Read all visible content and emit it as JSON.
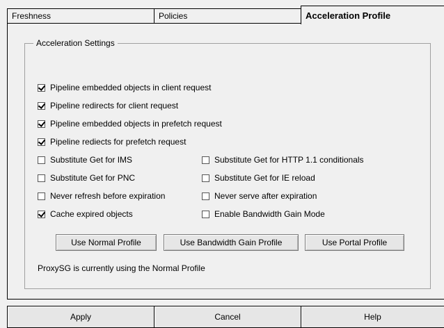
{
  "tabs": [
    {
      "label": "Freshness",
      "active": false
    },
    {
      "label": "Policies",
      "active": false
    },
    {
      "label": "Acceleration Profile",
      "active": true
    }
  ],
  "group": {
    "title": "Acceleration Settings",
    "checkboxes": [
      {
        "label": "Pipeline embedded objects in client request",
        "checked": true
      },
      {
        "label": "Pipeline redirects for client request",
        "checked": true
      },
      {
        "label": "Pipeline embedded objects in prefetch request",
        "checked": true
      },
      {
        "label": "Pipeline rediects for prefetch request",
        "checked": true
      },
      {
        "label": "Substitute Get for IMS",
        "checked": false
      },
      {
        "label": "Substitute Get for HTTP 1.1 conditionals",
        "checked": false
      },
      {
        "label": "Substitute Get for PNC",
        "checked": false
      },
      {
        "label": "Substitute Get for IE reload",
        "checked": false
      },
      {
        "label": "Never refresh before expiration",
        "checked": false
      },
      {
        "label": "Never serve after expiration",
        "checked": false
      },
      {
        "label": "Cache expired objects",
        "checked": true
      },
      {
        "label": "Enable Bandwidth Gain Mode",
        "checked": false
      }
    ],
    "buttons": {
      "normal": "Use Normal Profile",
      "bandwidth": "Use Bandwidth Gain Profile",
      "portal": "Use Portal Profile"
    },
    "status": "ProxySG is currently using the Normal Profile"
  },
  "footer": {
    "apply": "Apply",
    "cancel": "Cancel",
    "help": "Help"
  }
}
